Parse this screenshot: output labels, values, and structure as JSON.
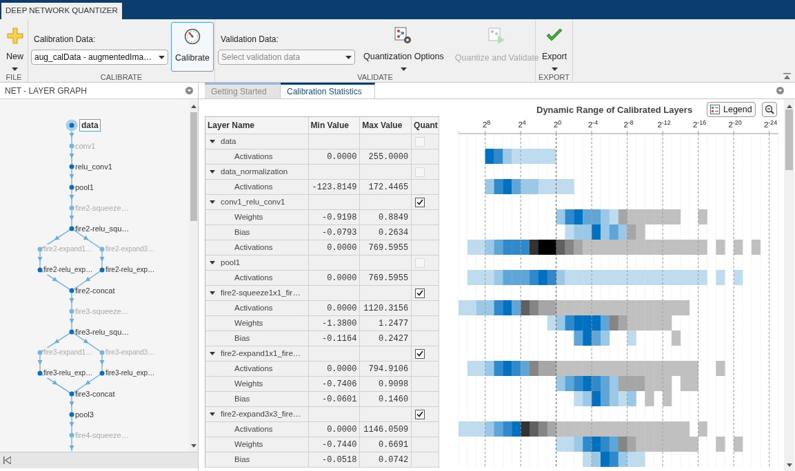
{
  "app_tab": {
    "label": "DEEP NETWORK QUANTIZER",
    "selected": true
  },
  "toolstrip": {
    "sections": [
      {
        "label": "FILE",
        "items": [
          {
            "kind": "button",
            "label": "New",
            "has_menu": true,
            "disabled": false,
            "focused": false
          }
        ]
      },
      {
        "label": "CALIBRATE",
        "items": [
          {
            "kind": "dropdown",
            "label": "Calibration Data:",
            "value": "aug_calData - augmentedIma…"
          },
          {
            "kind": "button",
            "label": "Calibrate",
            "has_menu": false,
            "disabled": false,
            "focused": true
          }
        ]
      },
      {
        "label": "VALIDATE",
        "items": [
          {
            "kind": "dropdown",
            "label": "Validation Data:",
            "placeholder": "Select validation data"
          },
          {
            "kind": "button",
            "label": "Quantization Options",
            "has_menu": true,
            "disabled": false,
            "focused": false
          },
          {
            "kind": "button",
            "label": "Quantize and Validate",
            "has_menu": false,
            "disabled": true,
            "focused": false
          }
        ]
      },
      {
        "label": "EXPORT",
        "items": [
          {
            "kind": "button",
            "label": "Export",
            "has_menu": true,
            "disabled": false,
            "focused": false
          }
        ]
      }
    ]
  },
  "layer_graph": {
    "title": "NET - LAYER GRAPH",
    "steps": [
      [
        {
          "label": "data",
          "dimmed": false,
          "selected": true
        }
      ],
      [
        {
          "label": "conv1",
          "dimmed": true,
          "selected": false
        }
      ],
      [
        {
          "label": "relu_conv1",
          "dimmed": false,
          "selected": false
        }
      ],
      [
        {
          "label": "pool1",
          "dimmed": false,
          "selected": false
        }
      ],
      [
        {
          "label": "fire2-squeeze…",
          "dimmed": true,
          "selected": false
        }
      ],
      [
        {
          "label": "fire2-relu_squ…",
          "dimmed": false,
          "selected": false
        }
      ],
      [
        {
          "label": "fire2-expand1…",
          "dimmed": true,
          "selected": false
        },
        {
          "label": "fire2-expand3…",
          "dimmed": true,
          "selected": false
        }
      ],
      [
        {
          "label": "fire2-relu_exp…",
          "dimmed": false,
          "selected": false
        },
        {
          "label": "fire2-relu_exp…",
          "dimmed": false,
          "selected": false
        }
      ],
      [
        {
          "label": "fire2-concat",
          "dimmed": false,
          "selected": false
        }
      ],
      [
        {
          "label": "fire3-squeeze…",
          "dimmed": true,
          "selected": false
        }
      ],
      [
        {
          "label": "fire3-relu_squ…",
          "dimmed": false,
          "selected": false
        }
      ],
      [
        {
          "label": "fire3-expand1…",
          "dimmed": true,
          "selected": false
        },
        {
          "label": "fire3-expand3…",
          "dimmed": true,
          "selected": false
        }
      ],
      [
        {
          "label": "fire3-relu_exp…",
          "dimmed": false,
          "selected": false
        },
        {
          "label": "fire3-relu_exp…",
          "dimmed": false,
          "selected": false
        }
      ],
      [
        {
          "label": "fire3-concat",
          "dimmed": false,
          "selected": false
        }
      ],
      [
        {
          "label": "pool3",
          "dimmed": false,
          "selected": false
        }
      ],
      [
        {
          "label": "fire4-squeeze…",
          "dimmed": true,
          "selected": false
        }
      ]
    ]
  },
  "doc_tabs": [
    {
      "label": "Getting Started",
      "selected": false
    },
    {
      "label": "Calibration Statistics",
      "selected": true
    }
  ],
  "table": {
    "columns": [
      "Layer Name",
      "Min Value",
      "Max Value",
      "Quant"
    ],
    "groups": [
      {
        "name": "data",
        "expanded": true,
        "checked": false,
        "disabled": true,
        "children": [
          {
            "name": "Activations",
            "min": "0.0000",
            "max": "255.0000"
          }
        ]
      },
      {
        "name": "data_normalization",
        "expanded": true,
        "checked": false,
        "disabled": true,
        "children": [
          {
            "name": "Activations",
            "min": "-123.8149",
            "max": "172.4465"
          }
        ]
      },
      {
        "name": "conv1_relu_conv1",
        "expanded": true,
        "checked": true,
        "disabled": false,
        "children": [
          {
            "name": "Weights",
            "min": "-0.9198",
            "max": "0.8849"
          },
          {
            "name": "Bias",
            "min": "-0.0793",
            "max": "0.2634"
          },
          {
            "name": "Activations",
            "min": "0.0000",
            "max": "769.5955"
          }
        ]
      },
      {
        "name": "pool1",
        "expanded": true,
        "checked": false,
        "disabled": true,
        "children": [
          {
            "name": "Activations",
            "min": "0.0000",
            "max": "769.5955"
          }
        ]
      },
      {
        "name": "fire2-squeeze1x1_fir…",
        "expanded": true,
        "checked": true,
        "disabled": false,
        "children": [
          {
            "name": "Activations",
            "min": "0.0000",
            "max": "1120.3156"
          },
          {
            "name": "Weights",
            "min": "-1.3800",
            "max": "1.2477"
          },
          {
            "name": "Bias",
            "min": "-0.1164",
            "max": "0.2427"
          }
        ]
      },
      {
        "name": "fire2-expand1x1_fire…",
        "expanded": true,
        "checked": true,
        "disabled": false,
        "children": [
          {
            "name": "Activations",
            "min": "0.0000",
            "max": "794.9106"
          },
          {
            "name": "Weights",
            "min": "-0.7406",
            "max": "0.9098"
          },
          {
            "name": "Bias",
            "min": "-0.0601",
            "max": "0.1460"
          }
        ]
      },
      {
        "name": "fire2-expand3x3_fire…",
        "expanded": true,
        "checked": true,
        "disabled": false,
        "children": [
          {
            "name": "Activations",
            "min": "0.0000",
            "max": "1146.0509"
          },
          {
            "name": "Weights",
            "min": "-0.7440",
            "max": "0.6691"
          },
          {
            "name": "Bias",
            "min": "-0.0518",
            "max": "0.0742"
          }
        ]
      }
    ]
  },
  "chart": {
    "title": "Dynamic Range of Calibrated Layers",
    "legend_button": "Legend",
    "ticks": [
      "2$^{8}$",
      "2$^{4}$",
      "2$^{0}$",
      "2$^{-4}$",
      "2$^{-8}$",
      "2$^{-12}$",
      "2$^{-16}$",
      "2$^{-20}$",
      "2$^{-24}$"
    ]
  }
}
